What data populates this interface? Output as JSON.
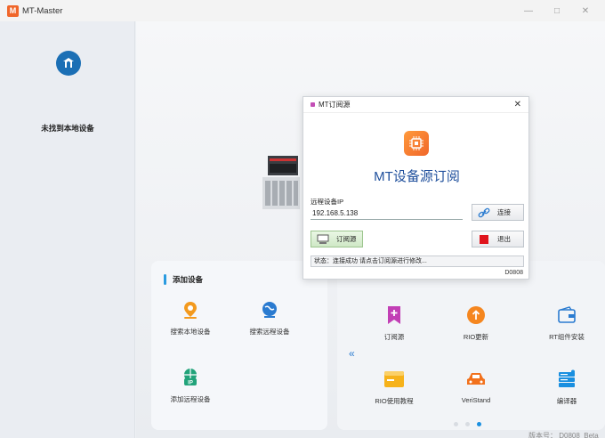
{
  "window": {
    "title": "MT-Master",
    "logo_text": "M",
    "minimize_glyph": "—",
    "maximize_glyph": "□",
    "close_glyph": "✕"
  },
  "sidebar": {
    "logo_icon": "mt-logo-icon",
    "message": "未找到本地设备"
  },
  "add_device_panel": {
    "title": "添加设备",
    "tiles": [
      {
        "label": "搜索本地设备",
        "icon": "location-pin-icon",
        "color": "#f39a1e"
      },
      {
        "label": "搜索远程设备",
        "icon": "globe-icon",
        "color": "#2a7bd0"
      },
      {
        "label": "添加远程设备",
        "icon": "ip-globe-icon",
        "color": "#21a37a"
      }
    ]
  },
  "tools_panel": {
    "prev_glyph": "«",
    "tiles": [
      {
        "label": "订阅源",
        "icon": "bookmark-plus-icon",
        "color": "#c23fb5"
      },
      {
        "label": "RIO更新",
        "icon": "arrow-up-circle-icon",
        "color": "#f5861f"
      },
      {
        "label": "RT组件安装",
        "icon": "wallet-icon",
        "color": "#2a7bd0"
      },
      {
        "label": "RIO使用教程",
        "icon": "window-icon",
        "color": "#f6b21a"
      },
      {
        "label": "VeriStand",
        "icon": "car-icon",
        "color": "#f2711c"
      },
      {
        "label": "编译器",
        "icon": "server-icon",
        "color": "#1a8fe0"
      }
    ],
    "page_count": 3,
    "active_page": 3
  },
  "version_text": "版本号： D0808_Beta",
  "dialog": {
    "title": "MT订阅源",
    "close_glyph": "✕",
    "heading": "MT设备源订阅",
    "ip_label": "远程设备IP",
    "ip_value": "192.168.5.138",
    "connect_label": "连接",
    "subscribe_label": "订阅源",
    "exit_label": "退出",
    "status_text": "状态：连接成功 请点击订阅源进行修改...",
    "code": "D0808"
  },
  "colors": {
    "accent": "#2a9be0",
    "brand_orange": "#f0662a",
    "heading_blue": "#1f4f9c",
    "exit_red": "#e0141c"
  }
}
